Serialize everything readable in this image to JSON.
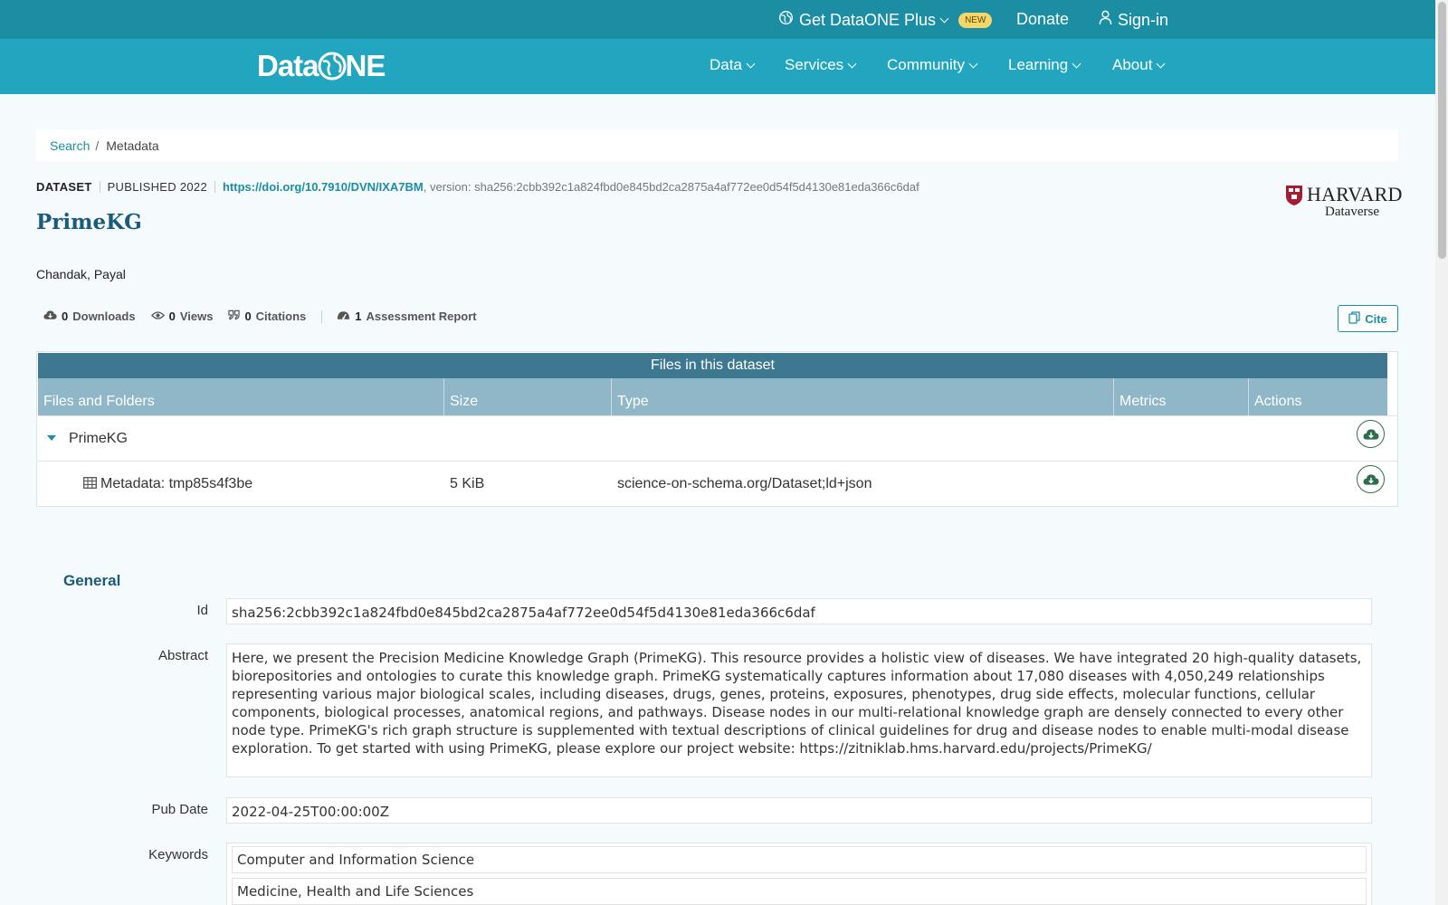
{
  "topbar": {
    "plus_label": "Get DataONE Plus",
    "new_badge": "NEW",
    "donate_label": "Donate",
    "signin_label": "Sign-in"
  },
  "brand": {
    "logo_left": "Data",
    "logo_right": "NE"
  },
  "nav": {
    "items": [
      {
        "label": "Data"
      },
      {
        "label": "Services"
      },
      {
        "label": "Community"
      },
      {
        "label": "Learning"
      },
      {
        "label": "About"
      }
    ]
  },
  "breadcrumb": {
    "search": "Search",
    "separator": "/",
    "current": "Metadata"
  },
  "dataset": {
    "type_label": "DATASET",
    "published": "PUBLISHED 2022",
    "doi": "https://doi.org/10.7910/DVN/IXA7BM",
    "version": ", version: sha256:2cbb392c1a824fbd0e845bd2ca2875a4af772ee0d54f5d4130e81eda366c6daf",
    "title": "PrimeKG",
    "author": "Chandak, Payal",
    "repository_name": "HARVARD",
    "repository_sub": "Dataverse"
  },
  "metrics": {
    "downloads_count": "0",
    "downloads_label": "Downloads",
    "views_count": "0",
    "views_label": "Views",
    "citations_count": "0",
    "citations_label": "Citations",
    "assessment_count": "1",
    "assessment_label": "Assessment Report"
  },
  "cite_label": "Cite",
  "files": {
    "title": "Files in this dataset",
    "columns": [
      "Files and Folders",
      "Size",
      "Type",
      "Metrics",
      "Actions"
    ],
    "folder": {
      "name": "PrimeKG"
    },
    "file": {
      "name": "Metadata: tmp85s4f3be",
      "size": "5 KiB",
      "type": "science-on-schema.org/Dataset;ld+json"
    }
  },
  "general": {
    "heading": "General",
    "id_label": "Id",
    "id_value": "sha256:2cbb392c1a824fbd0e845bd2ca2875a4af772ee0d54f5d4130e81eda366c6daf",
    "abstract_label": "Abstract",
    "abstract_value": "Here, we present the Precision Medicine Knowledge Graph (PrimeKG). This resource provides a holistic view of diseases. We have integrated 20 high-quality datasets, biorepositories and ontologies to curate this knowledge graph. PrimeKG systematically captures information about 17,080 diseases with 4,050,249 relationships representing various major biological scales, including diseases, drugs, genes, proteins, exposures, phenotypes, drug side effects, molecular functions, cellular components, biological processes, anatomical regions, and pathways. Disease nodes in our multi-relational knowledge graph are densely connected to every other node type. PrimeKG's rich graph structure is supplemented with textual descriptions of clinical guidelines for drug and disease nodes to enable multi-modal disease exploration. To get started with using PrimeKG, please explore our project website: https://zitniklab.hms.harvard.edu/projects/PrimeKG/",
    "pubdate_label": "Pub Date",
    "pubdate_value": "2022-04-25T00:00:00Z",
    "keywords_label": "Keywords",
    "keywords": [
      "Computer and Information Science",
      "Medicine, Health and Life Sciences"
    ]
  },
  "colors": {
    "topbar": "#1b8ea4",
    "navbar": "#22a6bf",
    "accent": "#1b8ea4",
    "table_title": "#3e7890",
    "table_head": "#8fb7c7"
  },
  "icons": [
    "globe-icon",
    "user-icon",
    "cloud-download-icon",
    "eye-icon",
    "quote-icon",
    "gauge-icon",
    "copy-icon",
    "table-icon",
    "caret-down-icon",
    "shield-icon"
  ]
}
